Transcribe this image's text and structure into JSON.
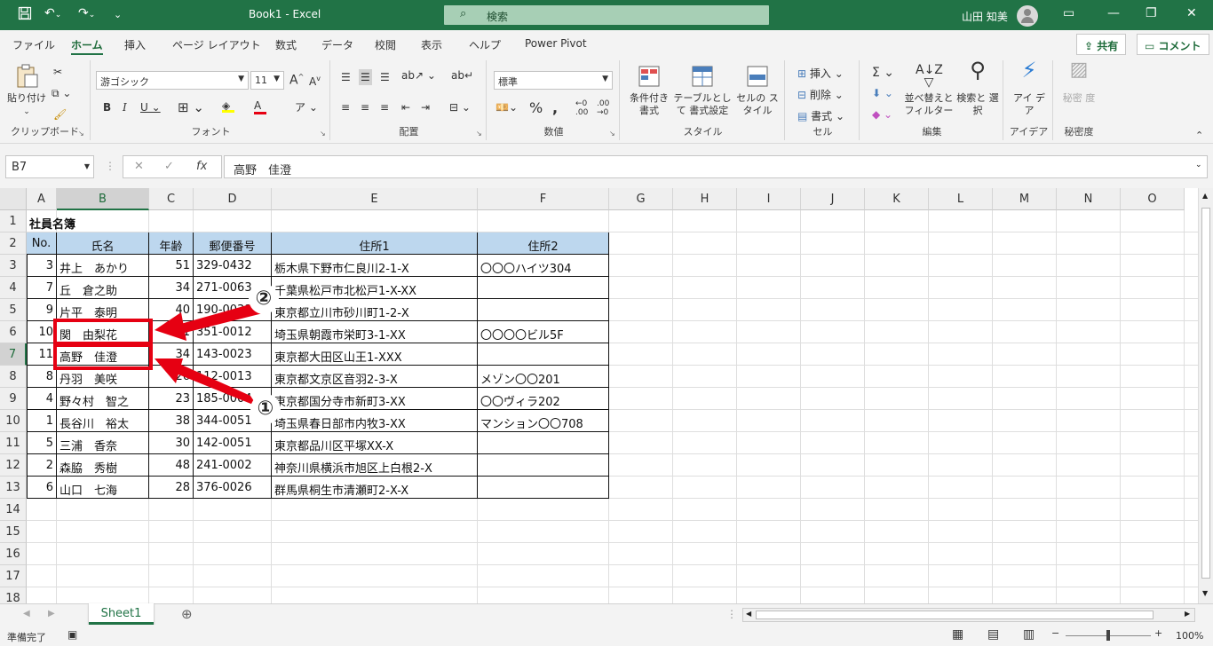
{
  "titlebar": {
    "doc_title": "Book1  -  Excel",
    "search_placeholder": "検索",
    "user_name": "山田 知美"
  },
  "menu": {
    "tabs": [
      "ファイル",
      "ホーム",
      "挿入",
      "ページ レイアウト",
      "数式",
      "データ",
      "校閲",
      "表示",
      "ヘルプ",
      "Power Pivot"
    ],
    "share_label": "共有",
    "comment_label": "コメント"
  },
  "ribbon": {
    "paste_label": "貼り付け",
    "clipboard_group": "クリップボード",
    "font_name": "游ゴシック",
    "font_size": "11",
    "font_group": "フォント",
    "align_group": "配置",
    "number_format": "標準",
    "number_group": "数値",
    "cond_format_label": "条件付き 書式",
    "table_format_label": "テーブルとして 書式設定",
    "cell_style_label": "セルの スタイル",
    "style_group": "スタイル",
    "insert_label": "挿入",
    "delete_label": "削除",
    "format_label": "書式",
    "cells_group": "セル",
    "sort_filter_label": "並べ替えと フィルター",
    "find_select_label": "検索と 選択",
    "edit_group": "編集",
    "ideas_label": "アイ デア",
    "ideas_group": "アイデア",
    "sensitivity_label": "秘密 度",
    "sensitivity_group": "秘密度"
  },
  "formula": {
    "name_box": "B7",
    "value": "高野　佳澄"
  },
  "sheet": {
    "columns": [
      "A",
      "B",
      "C",
      "D",
      "E",
      "F",
      "G",
      "H",
      "I",
      "J",
      "K",
      "L",
      "M",
      "N",
      "O"
    ],
    "rows": [
      "1",
      "2",
      "3",
      "4",
      "5",
      "6",
      "7",
      "8",
      "9",
      "10",
      "11",
      "12",
      "13",
      "14",
      "15",
      "16",
      "17",
      "18"
    ],
    "title": "社員名簿",
    "headers": [
      "No.",
      "氏名",
      "年齢",
      "郵便番号",
      "住所1",
      "住所2"
    ],
    "data": [
      [
        "3",
        "井上　あかり",
        "51",
        "329-0432",
        "栃木県下野市仁良川2-1-X",
        "〇〇〇ハイツ304"
      ],
      [
        "7",
        "丘　倉之助",
        "34",
        "271-0063",
        "千葉県松戸市北松戸1-X-XX",
        ""
      ],
      [
        "9",
        "片平　泰明",
        "40",
        "190-0031",
        "東京都立川市砂川町1-2-X",
        ""
      ],
      [
        "10",
        "関　由梨花",
        "41",
        "351-0012",
        "埼玉県朝霞市栄町3-1-XX",
        "〇〇〇〇ビル5F"
      ],
      [
        "11",
        "高野　佳澄",
        "34",
        "143-0023",
        "東京都大田区山王1-XXX",
        ""
      ],
      [
        "8",
        "丹羽　美咲",
        "26",
        "112-0013",
        "東京都文京区音羽2-3-X",
        "メゾン〇〇201"
      ],
      [
        "4",
        "野々村　智之",
        "23",
        "185-0004",
        "東京都国分寺市新町3-XX",
        "〇〇ヴィラ202"
      ],
      [
        "1",
        "長谷川　裕太",
        "38",
        "344-0051",
        "埼玉県春日部市内牧3-XX",
        "マンション〇〇708"
      ],
      [
        "5",
        "三浦　香奈",
        "30",
        "142-0051",
        "東京都品川区平塚XX-X",
        ""
      ],
      [
        "2",
        "森脇　秀樹",
        "48",
        "241-0002",
        "神奈川県横浜市旭区上白根2-X",
        ""
      ],
      [
        "6",
        "山口　七海",
        "28",
        "376-0026",
        "群馬県桐生市清瀬町2-X-X",
        ""
      ]
    ],
    "tab_name": "Sheet1"
  },
  "annotations": {
    "marker1": "①",
    "marker2": "②",
    "color": "#e60012"
  },
  "status": {
    "ready": "準備完了",
    "zoom": "100%"
  }
}
